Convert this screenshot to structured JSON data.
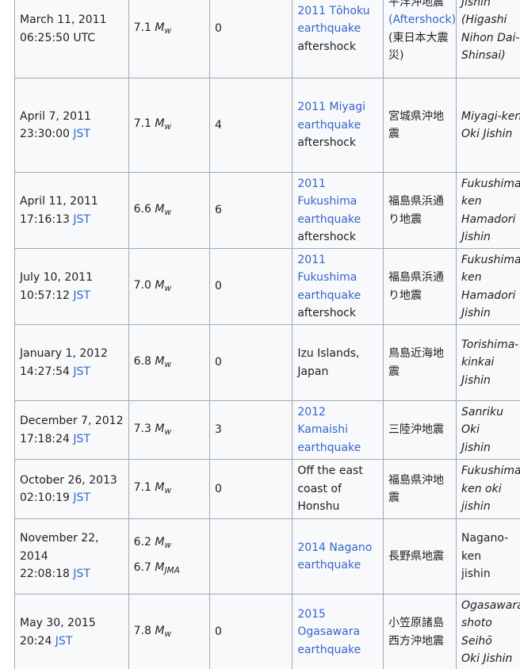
{
  "rows": [
    {
      "date": "March 11, 2011",
      "time": "06:25:50",
      "tz": "UTC",
      "tz_link": false,
      "magnitudes": [
        {
          "value": "7.1",
          "scale": "w"
        }
      ],
      "deaths": "0",
      "event_lines": [
        {
          "text": "2011 Tōhoku",
          "link": true
        },
        {
          "text": "earthquake",
          "link": true
        },
        {
          "text": "aftershock",
          "link": false
        }
      ],
      "jp_lines": [
        {
          "text": "平洋沖地震",
          "link": false
        },
        {
          "text": "(Aftershock)",
          "link": true
        },
        {
          "text": "(東日本大震",
          "link": false
        },
        {
          "text": "災)",
          "link": false
        }
      ],
      "romaji_lines": [
        {
          "text": "Jishin",
          "italic": true
        },
        {
          "text": "(Higashi",
          "italic": true
        },
        {
          "text": "Nihon Dai-",
          "italic": true
        },
        {
          "text": "Shinsai)",
          "italic": true
        }
      ],
      "height": 124
    },
    {
      "date": "April 7, 2011",
      "time": "23:30:00",
      "tz": "JST",
      "tz_link": true,
      "magnitudes": [
        {
          "value": "7.1",
          "scale": "w"
        }
      ],
      "deaths": "4",
      "event_lines": [
        {
          "text": "2011 Miyagi",
          "link": true
        },
        {
          "text": "earthquake",
          "link": true
        },
        {
          "text": "aftershock",
          "link": false
        }
      ],
      "jp_lines": [
        {
          "text": "宮城県沖地",
          "link": false
        },
        {
          "text": "震",
          "link": false
        }
      ],
      "romaji_lines": [
        {
          "text": "Miyagi-ken",
          "italic": true
        },
        {
          "text": "Oki Jishin",
          "italic": true
        }
      ],
      "height": 119
    },
    {
      "date": "April 11, 2011",
      "time": "17:16:13",
      "tz": "JST",
      "tz_link": true,
      "magnitudes": [
        {
          "value": "6.6",
          "scale": "w"
        }
      ],
      "deaths": "6",
      "event_lines": [
        {
          "text": "2011",
          "link": true
        },
        {
          "text": "Fukushima",
          "link": true
        },
        {
          "text": "earthquake",
          "link": true
        },
        {
          "text": "aftershock",
          "link": false
        }
      ],
      "jp_lines": [
        {
          "text": "福島県浜通",
          "link": false
        },
        {
          "text": "り地震",
          "link": false
        }
      ],
      "romaji_lines": [
        {
          "text": "Fukushima-",
          "italic": true
        },
        {
          "text": "ken Hamadori",
          "italic": true
        },
        {
          "text": "Jishin",
          "italic": true
        }
      ],
      "height": 96
    },
    {
      "date": "July 10, 2011",
      "time": "10:57:12",
      "tz": "JST",
      "tz_link": true,
      "magnitudes": [
        {
          "value": "7.0",
          "scale": "w"
        }
      ],
      "deaths": "0",
      "event_lines": [
        {
          "text": "2011",
          "link": true
        },
        {
          "text": "Fukushima",
          "link": true
        },
        {
          "text": "earthquake",
          "link": true
        },
        {
          "text": "aftershock",
          "link": false
        }
      ],
      "jp_lines": [
        {
          "text": "福島県浜通",
          "link": false
        },
        {
          "text": "り地震",
          "link": false
        }
      ],
      "romaji_lines": [
        {
          "text": "Fukushima-",
          "italic": true
        },
        {
          "text": "ken Hamadori",
          "italic": true
        },
        {
          "text": "Jishin",
          "italic": true
        }
      ],
      "height": 96
    },
    {
      "date": "January 1, 2012",
      "time": "14:27:54",
      "tz": "JST",
      "tz_link": true,
      "magnitudes": [
        {
          "value": "6.8",
          "scale": "w"
        }
      ],
      "deaths": "0",
      "event_lines": [
        {
          "text": "Izu Islands,",
          "link": false
        },
        {
          "text": "Japan",
          "link": false
        }
      ],
      "jp_lines": [
        {
          "text": "鳥島近海地",
          "link": false
        },
        {
          "text": "震",
          "link": false
        }
      ],
      "romaji_lines": [
        {
          "text": "Torishima-",
          "italic": true
        },
        {
          "text": "kinkai Jishin",
          "italic": true
        }
      ],
      "height": 96
    },
    {
      "date": "December 7, 2012",
      "time": "17:18:24",
      "tz": "JST",
      "tz_link": true,
      "magnitudes": [
        {
          "value": "7.3",
          "scale": "w"
        }
      ],
      "deaths": "3",
      "event_lines": [
        {
          "text": "2012 Kamaishi",
          "link": true
        },
        {
          "text": "earthquake",
          "link": true
        }
      ],
      "jp_lines": [
        {
          "text": "三陸沖地震",
          "link": false
        }
      ],
      "romaji_lines": [
        {
          "text": "Sanriku Oki",
          "italic": true
        },
        {
          "text": "Jishin",
          "italic": true
        }
      ],
      "height": 74
    },
    {
      "date": "October 26, 2013",
      "time": "02:10:19",
      "tz": "JST",
      "tz_link": true,
      "magnitudes": [
        {
          "value": "7.1",
          "scale": "w"
        }
      ],
      "deaths": "0",
      "event_lines": [
        {
          "text": "Off the east",
          "link": false
        },
        {
          "text": "coast of",
          "link": false
        },
        {
          "text": "Honshu",
          "link": false
        }
      ],
      "jp_lines": [
        {
          "text": "福島県沖地",
          "link": false
        },
        {
          "text": "震",
          "link": false
        }
      ],
      "romaji_lines": [
        {
          "text": "Fukushima-",
          "italic": true
        },
        {
          "text": "ken oki jishin",
          "italic": true
        }
      ],
      "height": 75
    },
    {
      "date": "November 22, 2014",
      "time": "22:08:18",
      "tz": "JST",
      "tz_link": true,
      "magnitudes": [
        {
          "value": "6.2",
          "scale": "w"
        },
        {
          "value": "6.7",
          "scale": "JMA"
        }
      ],
      "deaths": "",
      "event_lines": [
        {
          "text": "2014 Nagano",
          "link": true
        },
        {
          "text": "earthquake",
          "link": true
        }
      ],
      "jp_lines": [
        {
          "text": "長野県地震",
          "link": false
        }
      ],
      "romaji_lines": [
        {
          "text": "Nagano-ken",
          "italic": false
        },
        {
          "text": "jishin",
          "italic": false
        }
      ],
      "height": 95
    },
    {
      "date": "May 30, 2015",
      "time": "20:24",
      "tz": "JST",
      "tz_link": true,
      "magnitudes": [
        {
          "value": "7.8",
          "scale": "w"
        }
      ],
      "deaths": "0",
      "event_lines": [
        {
          "text": "2015",
          "link": true
        },
        {
          "text": "Ogasawara",
          "link": true
        },
        {
          "text": "earthquake",
          "link": true
        }
      ],
      "jp_lines": [
        {
          "text": "小笠原諸島",
          "link": false
        },
        {
          "text": "西方沖地震",
          "link": false
        }
      ],
      "romaji_lines": [
        {
          "text": "Ogasawara-",
          "italic": true
        },
        {
          "text": "shoto Seihō",
          "italic": true
        },
        {
          "text": "Oki Jishin",
          "italic": true
        }
      ],
      "height": 96
    }
  ]
}
